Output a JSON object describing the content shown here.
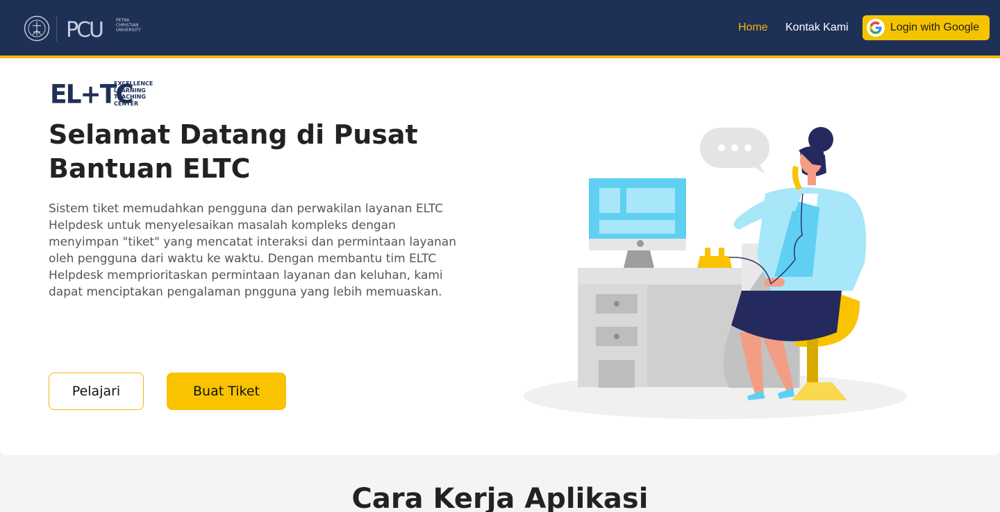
{
  "header": {
    "brand": {
      "seal_icon": "university-seal-icon",
      "logo_text": "PCU",
      "logo_subtext": [
        "PETRA",
        "CHRISTIAN",
        "UNIVERSITY"
      ]
    },
    "nav": {
      "home": "Home",
      "contact": "Kontak Kami"
    },
    "login": {
      "label": "Login with Google",
      "icon": "google-icon"
    }
  },
  "hero": {
    "logo": {
      "big": "EL+TC",
      "small": [
        "EXCELLENCE",
        "LEARNING",
        "TEACHING",
        "CENTER"
      ]
    },
    "title": "Selamat Datang di Pusat Bantuan ELTC",
    "description": "Sistem tiket memudahkan pengguna dan perwakilan layanan ELTC Helpdesk untuk menyelesaikan masalah kompleks dengan menyimpan \"tiket\" yang mencatat interaksi dan permintaan layanan oleh pengguna dari waktu ke waktu. Dengan membantu tim ELTC Helpdesk memprioritaskan permintaan layanan dan keluhan, kami dapat menciptakan pengalaman pngguna yang lebih memuaskan.",
    "buttons": {
      "learn": "Pelajari",
      "create_ticket": "Buat Tiket"
    },
    "illustration": "helpdesk-agent-illustration"
  },
  "section2": {
    "title": "Cara Kerja Aplikasi"
  },
  "colors": {
    "navy": "#1f3057",
    "accent": "#f5b800"
  }
}
